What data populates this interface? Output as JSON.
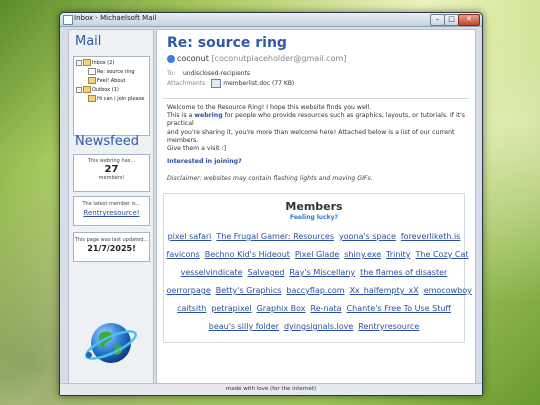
{
  "window": {
    "title": "Inbox - Michaelsoft Mail",
    "minimize": "–",
    "maximize": "□",
    "close": "✕"
  },
  "sidebar": {
    "mail_heading": "Mail",
    "tree": {
      "inbox": "Inbox (2)",
      "inbox_items": [
        "Re: source ring",
        "Feel! About"
      ],
      "outbox": "Outbox (1)",
      "outbox_items": [
        "Hi can i join please"
      ]
    },
    "newsfeed_heading": "Newsfeed",
    "webring_box": {
      "line1": "This webring has...",
      "count": "27",
      "line2": "members!"
    },
    "latest_box": {
      "line1": "The latest member is...",
      "name": "Rentryresource!"
    },
    "updated_box": {
      "line1": "This page was last updated...",
      "date": "21/7/2025!"
    }
  },
  "email": {
    "subject": "Re: source ring",
    "sender_name": "coconut",
    "sender_email": "[coconutplaceholder@gmail.com]",
    "to_label": "To:",
    "to_value": "undisclosed-recipients",
    "attachments_label": "Attachments:",
    "attachment": "memberlist.doc (77 KB)",
    "body": {
      "line1": "Welcome to the Resource Ring! I hope this website finds you well.",
      "line2_pre": "This is a ",
      "line2_link": "webring",
      "line2_post": " for people who provide resources such as graphics, layouts, or tutorials. If it's practical",
      "line3": "and you're sharing it, you're more than welcome here! Attached below is a list of our current members.",
      "line4": "Give them a visit :]"
    },
    "question": "Interested in joining?",
    "disclaimer": "Disclaimer: websites may contain flashing lights and moving GIFs."
  },
  "members": {
    "title": "Members",
    "lucky": "Feeling lucky?",
    "rows": [
      [
        "pixel safari",
        "The Frugal Gamer: Resources",
        "yoona's space",
        "foreverliketh.is"
      ],
      [
        "favicons",
        "Bechno Kid's Hideout",
        "Pixel Glade",
        "shiny.exe",
        "Trinity",
        "The Cozy Cat"
      ],
      [
        "vesselvindicate",
        "Salvaged",
        "Ray's Miscellany",
        "the flames of disaster"
      ],
      [
        "oerrorpage",
        "Betty's Graphics",
        "baccyflap.com",
        "Xx_halfempty_xX",
        "emocowboy"
      ],
      [
        "caitsith",
        "petrapixel",
        "Graphix Box",
        "Re-nata",
        "Chante's Free To Use Stuff"
      ],
      [
        "beau's silly folder",
        "dyingsignals.love",
        "Rentryresource"
      ]
    ]
  },
  "status_bar": "made with love (for the internet)",
  "colors": {
    "accent": "#2f5aa6",
    "link": "#2a4fa0",
    "lucky": "#2a7ad0"
  }
}
